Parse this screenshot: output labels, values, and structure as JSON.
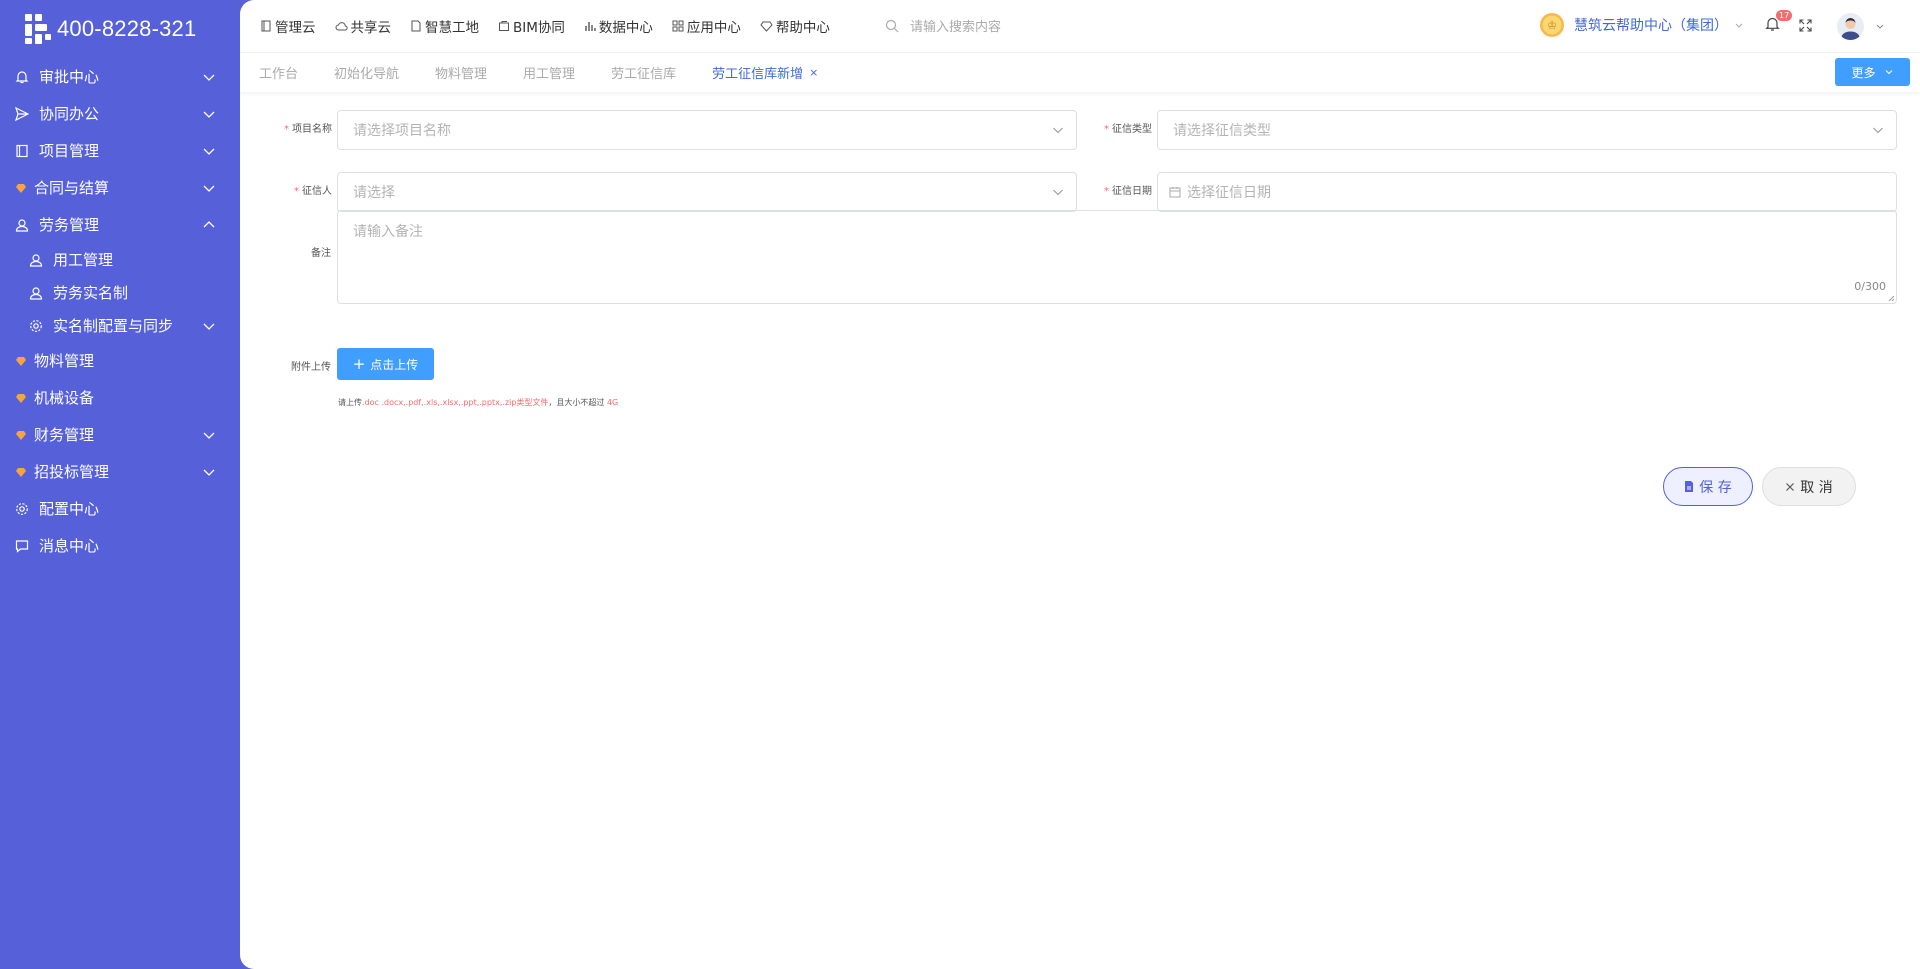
{
  "sidebar": {
    "phone": "400-8228-321",
    "items": [
      {
        "label": "审批中心"
      },
      {
        "label": "协同办公"
      },
      {
        "label": "项目管理"
      },
      {
        "label": "合同与结算"
      },
      {
        "label": "劳务管理"
      },
      {
        "label": "用工管理"
      },
      {
        "label": "劳务实名制"
      },
      {
        "label": "实名制配置与同步"
      },
      {
        "label": "物料管理"
      },
      {
        "label": "机械设备"
      },
      {
        "label": "财务管理"
      },
      {
        "label": "招投标管理"
      },
      {
        "label": "配置中心"
      },
      {
        "label": "消息中心"
      }
    ]
  },
  "topbar": {
    "nav": [
      "管理云",
      "共享云",
      "智慧工地",
      "BIM协同",
      "数据中心",
      "应用中心",
      "帮助中心"
    ],
    "search_placeholder": "请输入搜索内容",
    "org_name": "慧筑云帮助中心（集团）",
    "notification_count": "17"
  },
  "tabs": {
    "items": [
      "工作台",
      "初始化导航",
      "物料管理",
      "用工管理",
      "劳工征信库",
      "劳工征信库新增"
    ],
    "active_index": 5,
    "close_glyph": "×",
    "more_label": "更多"
  },
  "form": {
    "project_label": "项目名称",
    "project_placeholder": "请选择项目名称",
    "credit_type_label": "征信类型",
    "credit_type_placeholder": "请选择征信类型",
    "person_label": "征信人",
    "person_placeholder": "请选择",
    "date_label": "征信日期",
    "date_placeholder": "选择征信日期",
    "remark_label": "备注",
    "remark_placeholder": "请输入备注",
    "remark_counter": "0/300",
    "attach_label": "附件上传",
    "upload_label": "点击上传",
    "hint_prefix": "请上传",
    "hint_types": ".doc .docx,.pdf,.xls,.xlsx,.ppt,.pptx,.zip类型文件",
    "hint_mid": "，且大小不超过",
    "hint_size": "4G",
    "required_mark": "*",
    "save_label": "保 存",
    "cancel_label": "取 消"
  },
  "colors": {
    "sidebar_bg": "#5560d9",
    "primary": "#409eff",
    "link_blue": "#3f6ad8",
    "required_red": "#f56c6c"
  }
}
